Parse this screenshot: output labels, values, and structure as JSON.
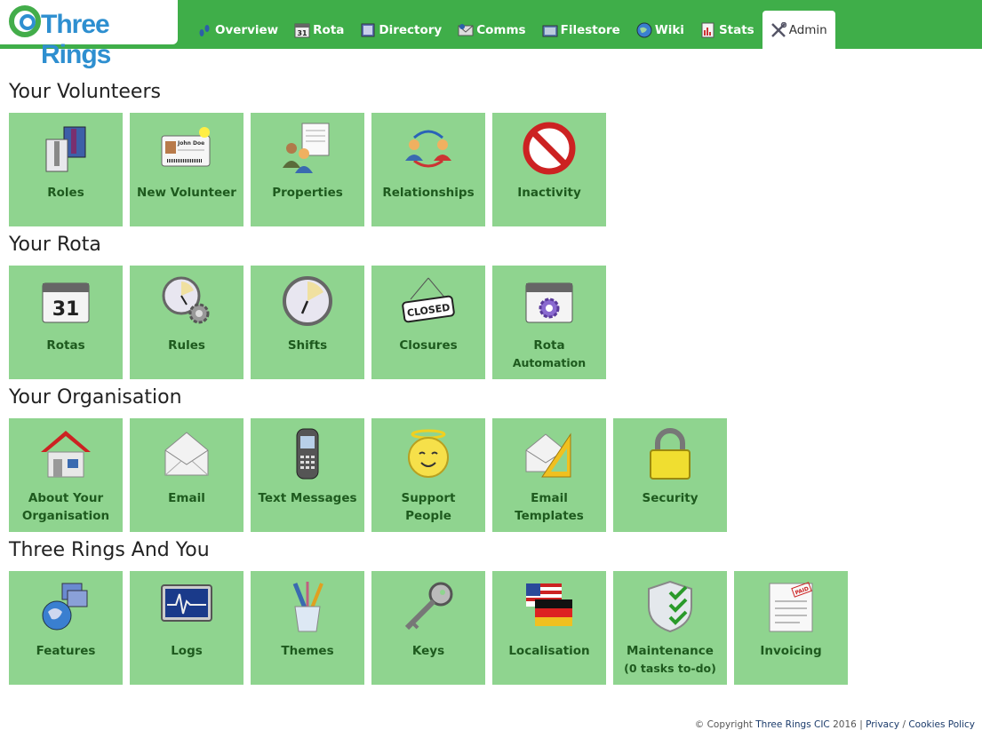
{
  "brand": {
    "name": "Three Rings",
    "ring_green": "#43ad4a",
    "ring_blue": "#2e8fd0"
  },
  "colors": {
    "header_bg": "#3fae49",
    "tile_bg": "#8fd48f",
    "tile_text": "#1e5a1e"
  },
  "nav": [
    {
      "label": "Overview",
      "icon": "footprints-icon"
    },
    {
      "label": "Rota",
      "icon": "calendar-icon"
    },
    {
      "label": "Directory",
      "icon": "book-icon"
    },
    {
      "label": "Comms",
      "icon": "mail-icon"
    },
    {
      "label": "Filestore",
      "icon": "folder-icon"
    },
    {
      "label": "Wiki",
      "icon": "globe-icon"
    },
    {
      "label": "Stats",
      "icon": "chart-icon"
    },
    {
      "label": "Admin",
      "icon": "tools-icon",
      "active": true
    }
  ],
  "sections": [
    {
      "title": "Your Volunteers",
      "tiles": [
        {
          "label": "Roles",
          "icon": "shirts-icon"
        },
        {
          "label": "New Volunteer",
          "icon": "id-card-icon"
        },
        {
          "label": "Properties",
          "icon": "people-document-icon"
        },
        {
          "label": "Relationships",
          "icon": "people-cycle-icon"
        },
        {
          "label": "Inactivity",
          "icon": "prohibited-icon"
        }
      ]
    },
    {
      "title": "Your Rota",
      "tiles": [
        {
          "label": "Rotas",
          "icon": "calendar-icon",
          "badge": "31"
        },
        {
          "label": "Rules",
          "icon": "clock-gear-icon"
        },
        {
          "label": "Shifts",
          "icon": "clock-icon"
        },
        {
          "label": "Closures",
          "icon": "closed-sign-icon",
          "badge": "CLOSED"
        },
        {
          "label": "Rota",
          "sub": "Automation",
          "icon": "calendar-gear-icon"
        }
      ]
    },
    {
      "title": "Your Organisation",
      "tiles": [
        {
          "label": "About Your",
          "sub": "Organisation",
          "icon": "house-icon"
        },
        {
          "label": "Email",
          "icon": "envelope-icon"
        },
        {
          "label": "Text Messages",
          "icon": "mobile-phone-icon"
        },
        {
          "label": "Support",
          "sub": "People",
          "icon": "angel-smiley-icon"
        },
        {
          "label": "Email",
          "sub": "Templates",
          "icon": "envelope-ruler-icon"
        },
        {
          "label": "Security",
          "icon": "padlock-icon"
        }
      ]
    },
    {
      "title": "Three Rings And You",
      "tiles": [
        {
          "label": "Features",
          "icon": "globe-windows-icon"
        },
        {
          "label": "Logs",
          "icon": "monitor-pulse-icon"
        },
        {
          "label": "Themes",
          "icon": "brushes-cup-icon"
        },
        {
          "label": "Keys",
          "icon": "key-icon"
        },
        {
          "label": "Localisation",
          "icon": "flags-icon"
        },
        {
          "label": "Maintenance",
          "sub": "(0 tasks to-do)",
          "icon": "shield-check-icon"
        },
        {
          "label": "Invoicing",
          "icon": "invoice-paid-icon",
          "badge": "PAID"
        }
      ]
    }
  ],
  "footer": {
    "copyright": "© Copyright",
    "org": "Three Rings CIC",
    "year": "2016",
    "sep": "|",
    "privacy": "Privacy",
    "slash": "/",
    "cookies": "Cookies Policy"
  }
}
